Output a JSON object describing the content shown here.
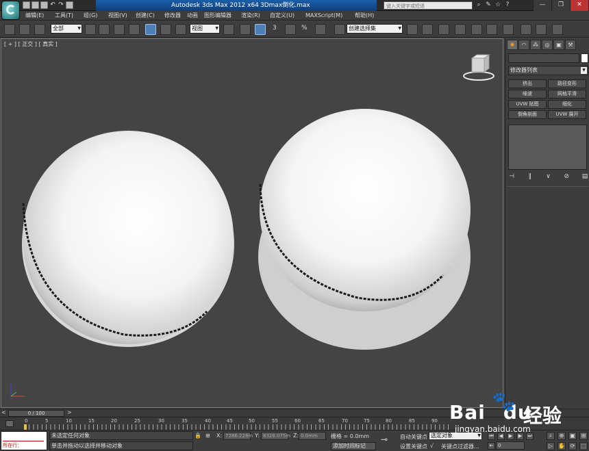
{
  "title": {
    "app": "Autodesk 3ds Max  2012 x64",
    "file": "3Dmax倒化.max",
    "search_placeholder": "键入关键字或短语"
  },
  "menu": [
    "编辑(E)",
    "工具(T)",
    "组(G)",
    "视图(V)",
    "创建(C)",
    "修改器",
    "动画",
    "图形编辑器",
    "渲染(R)",
    "自定义(U)",
    "MAXScript(M)",
    "帮助(H)"
  ],
  "toolbar": {
    "selection_filter": "全部",
    "ref_coord": "视图",
    "named_selection": "创建选择集",
    "snap_3": "3",
    "snap_angle": "⁴",
    "snap_percent": "%",
    "snap_spinner": "ⁿ"
  },
  "viewport": {
    "label": "[ + ] [ 正交 ] [ 真实 ]"
  },
  "command_panel": {
    "modifier_list": "修改器列表",
    "modifiers": [
      [
        "挤出",
        "路径变形"
      ],
      [
        "噪波",
        "网格平滑"
      ],
      [
        "UVW 贴图",
        "细化"
      ],
      [
        "倒角剖面",
        "UVW 展开"
      ]
    ]
  },
  "timeslider": {
    "thumb": "0 / 100",
    "ticks": [
      "0",
      "5",
      "10",
      "15",
      "20",
      "25",
      "30",
      "35",
      "40",
      "45",
      "50",
      "55",
      "60",
      "65",
      "70",
      "75",
      "80",
      "85",
      "90"
    ]
  },
  "status": {
    "maxscript_label": "所在行：",
    "prompt1": "未选定任何对象",
    "prompt2": "单击并拖动以选择并移动对象",
    "x_label": "X:",
    "x_value": "7286.228m",
    "y_label": "Y:",
    "y_value": "8328.075m",
    "z_label": "Z:",
    "z_value": "0.0mm",
    "grid": "栅格 = 0.0mm",
    "add_time_tag": "添加时间标记",
    "auto_key": "自动关键点",
    "set_key": "设置关键点",
    "selected_object": "选定对象",
    "key_filters": "关键点过滤器...",
    "frame": "0"
  },
  "watermark": {
    "brand": "Bai",
    "brand2": "du",
    "cn": "经验",
    "url": "jingyan.baidu.com"
  },
  "colors": {
    "title_accent": "#1a5ea8",
    "active_tool": "#4e7fb8",
    "viewport_bg": "#444444",
    "sphere_highlight": "#ffffff",
    "create_tab": "#f2a020"
  }
}
